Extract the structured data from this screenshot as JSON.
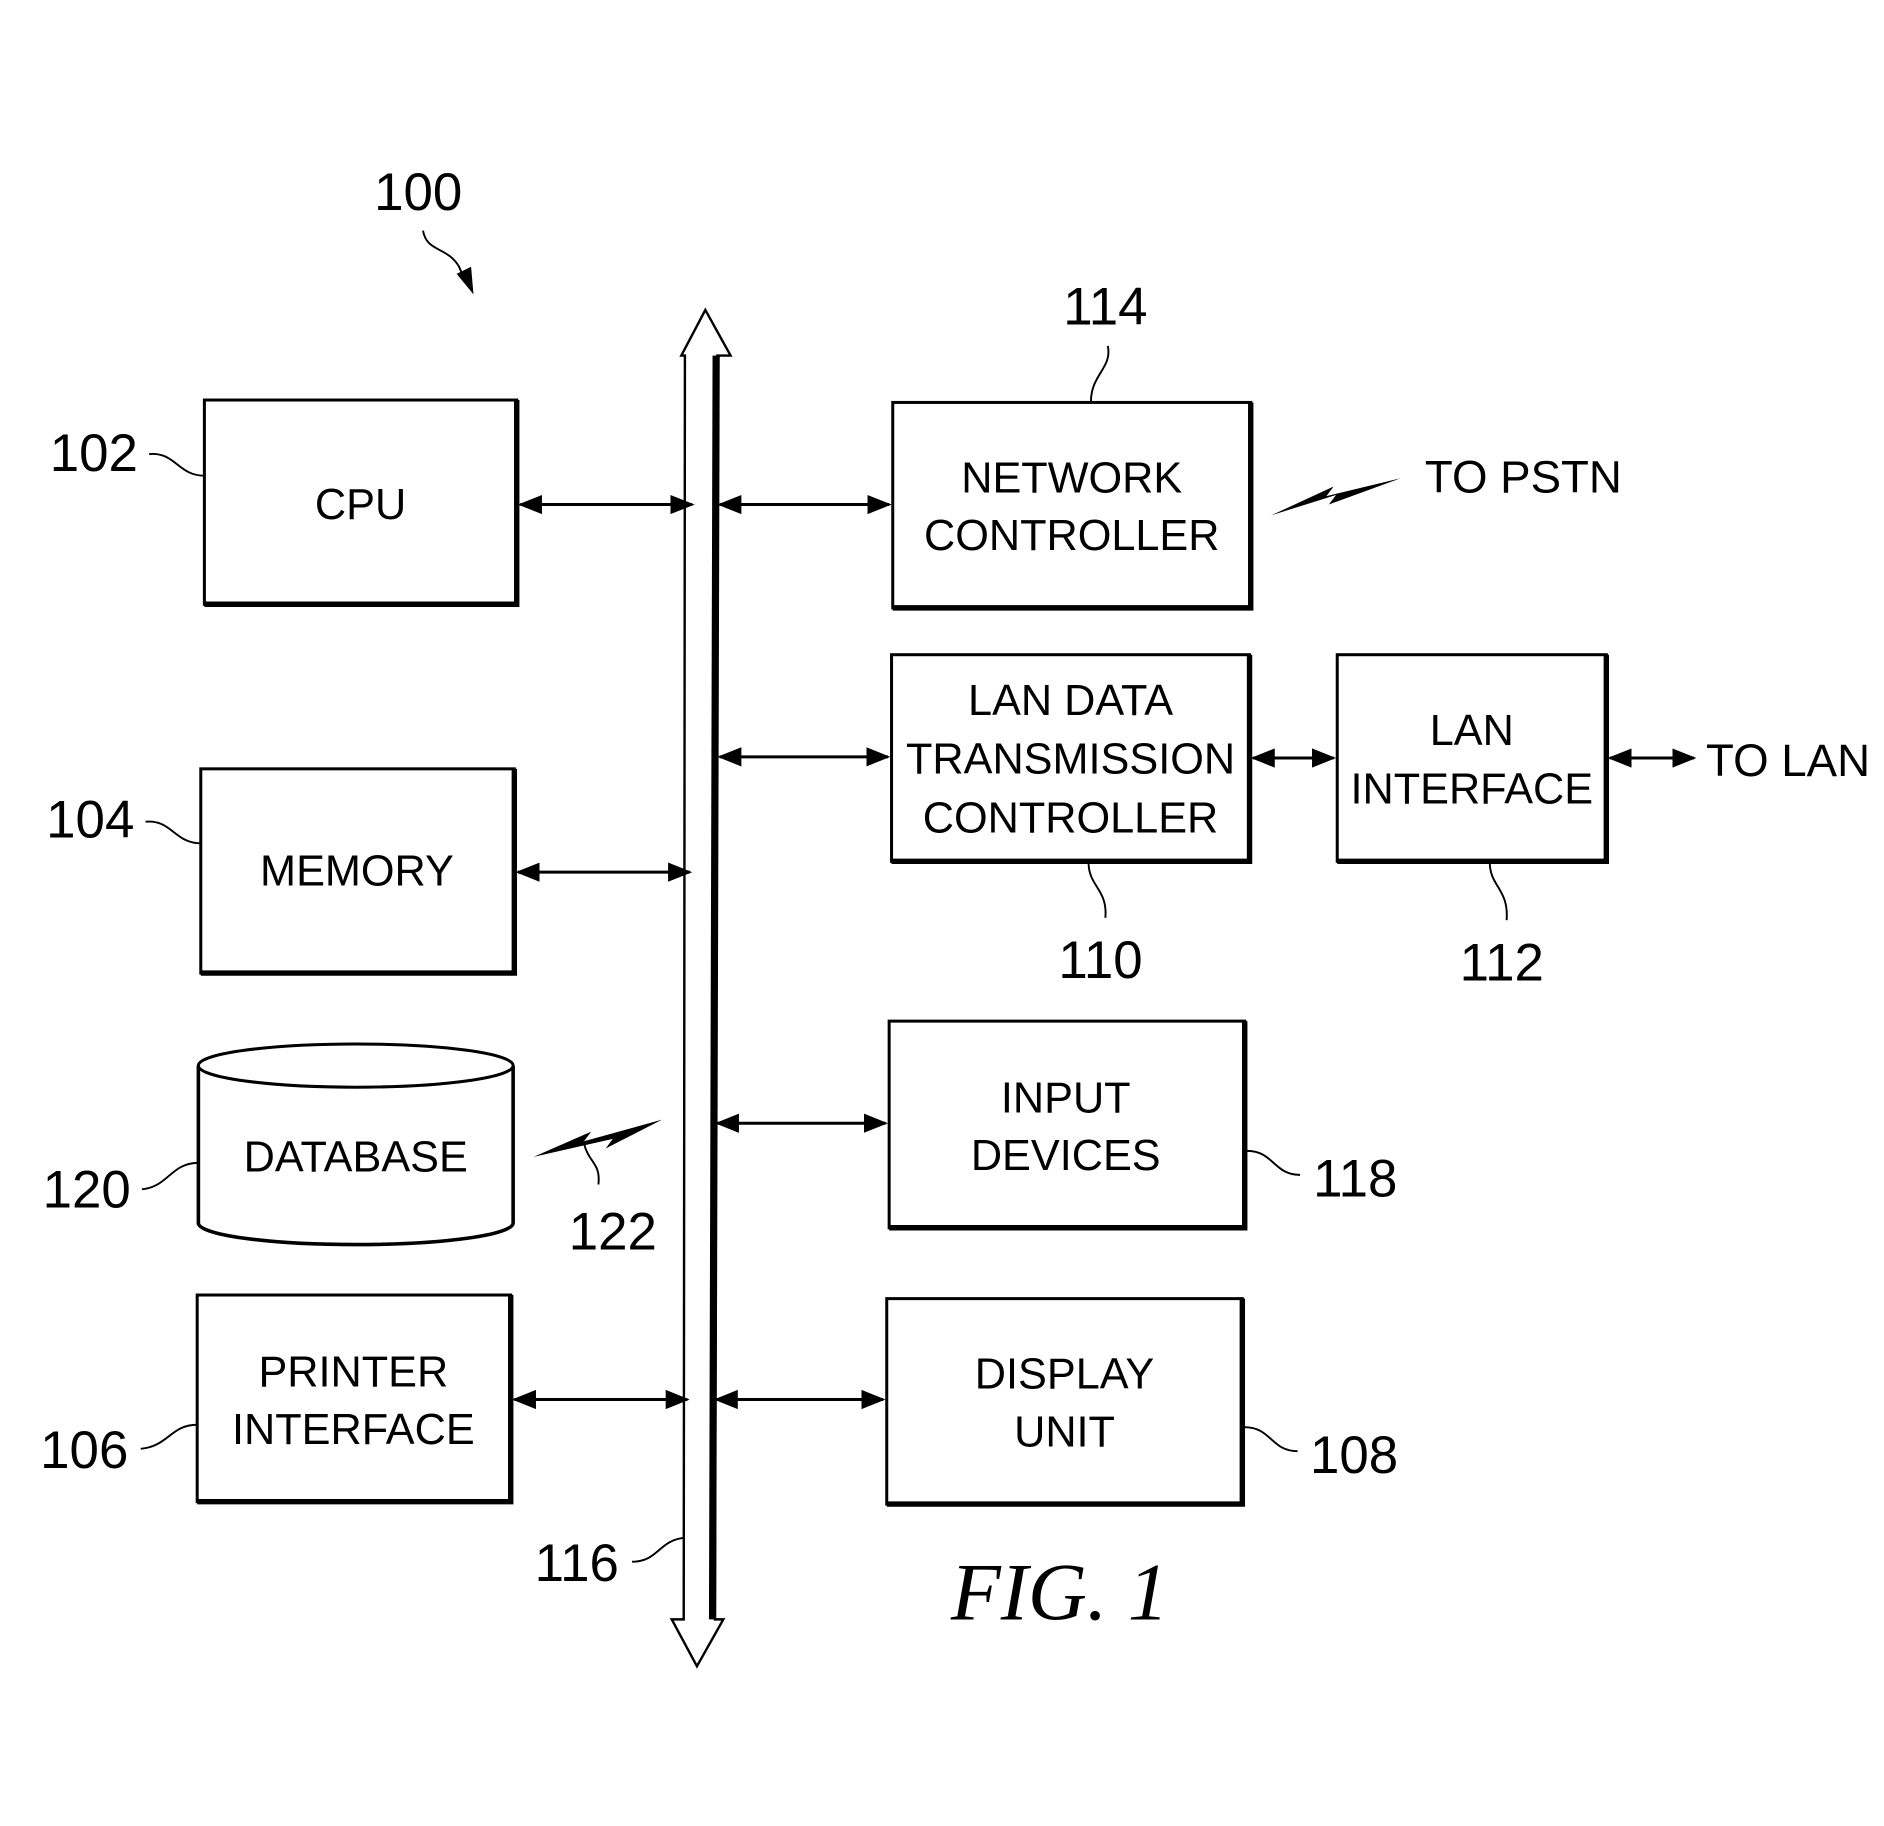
{
  "figure": {
    "caption": "FIG. 1",
    "system_ref": "100",
    "bus": {
      "ref": "116"
    },
    "wireless_link_ref": "122",
    "blocks": {
      "cpu": {
        "lines": [
          "CPU"
        ],
        "ref": "102"
      },
      "memory": {
        "lines": [
          "MEMORY"
        ],
        "ref": "104"
      },
      "database": {
        "lines": [
          "DATABASE"
        ],
        "ref": "120"
      },
      "printer_interface": {
        "lines": [
          "PRINTER",
          "INTERFACE"
        ],
        "ref": "106"
      },
      "network_controller": {
        "lines": [
          "NETWORK",
          "CONTROLLER"
        ],
        "ref": "114"
      },
      "lan_data_transmission_controller": {
        "lines": [
          "LAN DATA",
          "TRANSMISSION",
          "CONTROLLER"
        ],
        "ref": "110"
      },
      "lan_interface": {
        "lines": [
          "LAN",
          "INTERFACE"
        ],
        "ref": "112"
      },
      "input_devices": {
        "lines": [
          "INPUT",
          "DEVICES"
        ],
        "ref": "118"
      },
      "display_unit": {
        "lines": [
          "DISPLAY",
          "UNIT"
        ],
        "ref": "108"
      }
    },
    "external": {
      "to_pstn": "TO PSTN",
      "to_lan": "TO LAN"
    }
  }
}
